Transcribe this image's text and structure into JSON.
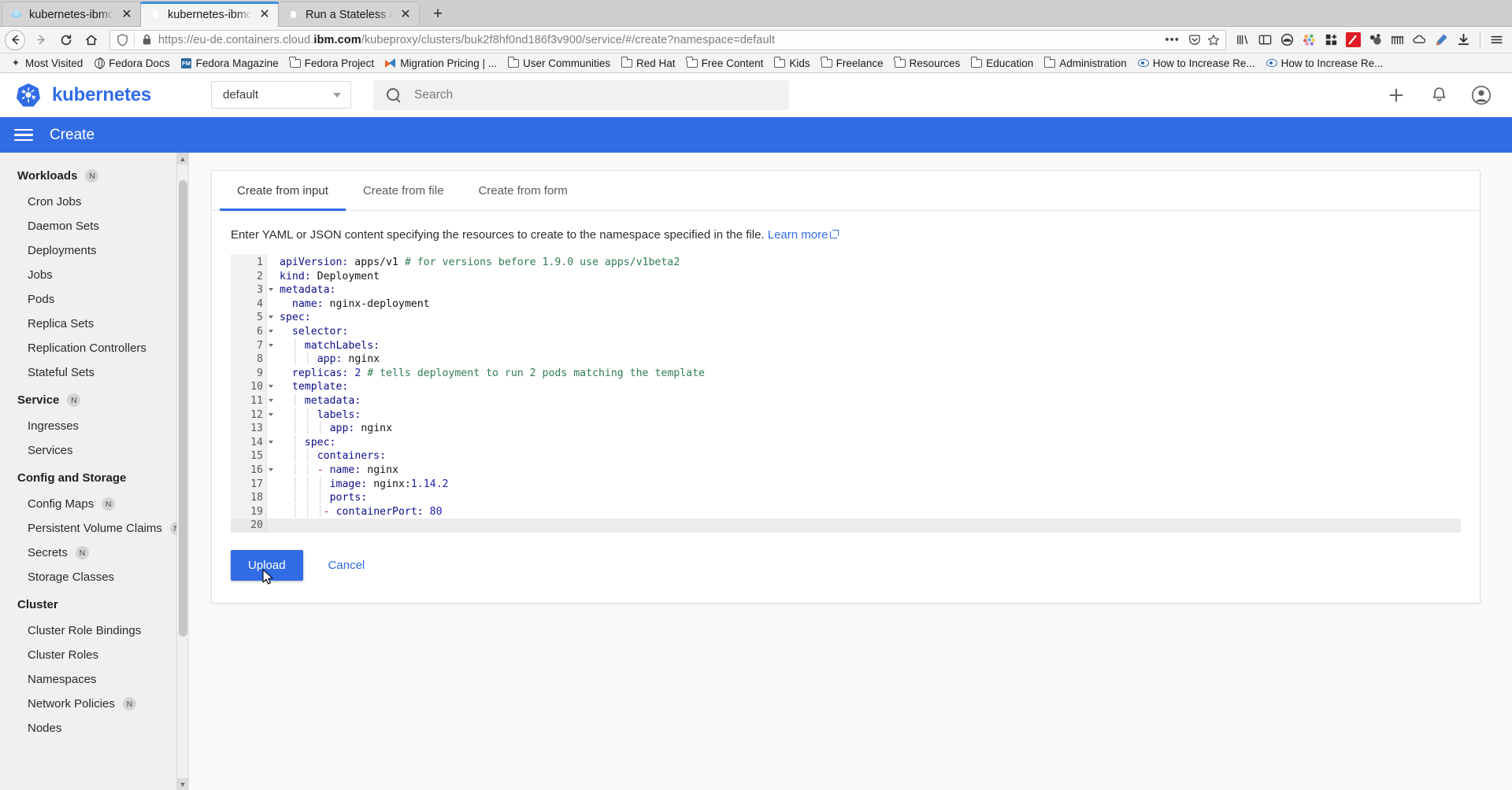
{
  "browser": {
    "tabs": [
      {
        "title": "kubernetes-ibmcloud - IB",
        "favicon": "cloud-icon",
        "active": false,
        "close_label": "✕"
      },
      {
        "title": "kubernetes-ibmcloud - K",
        "favicon": "kubernetes-icon",
        "active": true,
        "close_label": "✕"
      },
      {
        "title": "Run a Stateless Applicat",
        "favicon": "kubernetes-icon",
        "active": false,
        "close_label": "✕"
      }
    ],
    "new_tab_label": "+",
    "nav": {
      "back_label": "←",
      "forward_label": "→",
      "reload_label": "↻",
      "home_label": "⌂"
    },
    "url": {
      "scheme": "https://eu-de.containers.cloud.",
      "domain": "ibm.com",
      "path": "/kubeproxy/clusters/buk2f8hf0nd186f3v900/service/#/create?namespace=default",
      "shield_icon": "shield-icon",
      "lock_icon": "lock-icon",
      "overflow_label": "•••",
      "pocket_icon": "pocket-icon",
      "bookmark_star_icon": "star-icon"
    },
    "toolbar_icons": [
      "library-icon",
      "sidebar-icon",
      "containers-icon",
      "palette-icon",
      "grid-plus-icon",
      "wand-icon",
      "molecule-icon",
      "comb-icon",
      "cloud-icon",
      "highlighter-icon",
      "downloads-icon"
    ],
    "menu_icon": "hamburger-menu-icon",
    "bookmarks": [
      {
        "label": "Most Visited",
        "icon": "star-icon"
      },
      {
        "label": "Fedora Docs",
        "icon": "globe-icon"
      },
      {
        "label": "Fedora Magazine",
        "icon": "fm-icon"
      },
      {
        "label": "Fedora Project",
        "icon": "folder-icon"
      },
      {
        "label": "Migration Pricing | ...",
        "icon": "pin-icon"
      },
      {
        "label": "User Communities",
        "icon": "folder-icon"
      },
      {
        "label": "Red Hat",
        "icon": "folder-icon"
      },
      {
        "label": "Free Content",
        "icon": "folder-icon"
      },
      {
        "label": "Kids",
        "icon": "folder-icon"
      },
      {
        "label": "Freelance",
        "icon": "folder-icon"
      },
      {
        "label": "Resources",
        "icon": "folder-icon"
      },
      {
        "label": "Education",
        "icon": "folder-icon"
      },
      {
        "label": "Administration",
        "icon": "folder-icon"
      },
      {
        "label": "How to Increase Re...",
        "icon": "eye-icon"
      },
      {
        "label": "How to Increase Re...",
        "icon": "eye-icon"
      }
    ]
  },
  "app": {
    "brand_name": "kubernetes",
    "namespace_value": "default",
    "namespace_caret": "chevron-down-icon",
    "search_placeholder": "Search",
    "header_actions": [
      {
        "name": "add-button",
        "label": "+"
      },
      {
        "name": "notifications-button",
        "label": "🔔"
      },
      {
        "name": "account-button",
        "label": "👤"
      }
    ],
    "page_title": "Create",
    "accent_color": "#326ce5"
  },
  "sidebar": {
    "sections": [
      {
        "title": "Workloads",
        "badge": "N",
        "items": [
          {
            "label": "Cron Jobs",
            "badge": null
          },
          {
            "label": "Daemon Sets",
            "badge": null
          },
          {
            "label": "Deployments",
            "badge": null
          },
          {
            "label": "Jobs",
            "badge": null
          },
          {
            "label": "Pods",
            "badge": null
          },
          {
            "label": "Replica Sets",
            "badge": null
          },
          {
            "label": "Replication Controllers",
            "badge": null
          },
          {
            "label": "Stateful Sets",
            "badge": null
          }
        ]
      },
      {
        "title": "Service",
        "badge": "N",
        "items": [
          {
            "label": "Ingresses",
            "badge": null
          },
          {
            "label": "Services",
            "badge": null
          }
        ]
      },
      {
        "title": "Config and Storage",
        "badge": null,
        "items": [
          {
            "label": "Config Maps",
            "badge": "N"
          },
          {
            "label": "Persistent Volume Claims",
            "badge": "N"
          },
          {
            "label": "Secrets",
            "badge": "N"
          },
          {
            "label": "Storage Classes",
            "badge": null
          }
        ]
      },
      {
        "title": "Cluster",
        "badge": null,
        "items": [
          {
            "label": "Cluster Role Bindings",
            "badge": null
          },
          {
            "label": "Cluster Roles",
            "badge": null
          },
          {
            "label": "Namespaces",
            "badge": null
          },
          {
            "label": "Network Policies",
            "badge": "N"
          },
          {
            "label": "Nodes",
            "badge": null
          }
        ]
      }
    ],
    "scroll_up_icon": "chevron-up-icon",
    "scroll_down_icon": "chevron-down-icon"
  },
  "main": {
    "tabs": [
      {
        "label": "Create from input",
        "active": true
      },
      {
        "label": "Create from file",
        "active": false
      },
      {
        "label": "Create from form",
        "active": false
      }
    ],
    "description": "Enter YAML or JSON content specifying the resources to create to the namespace specified in the file.",
    "learn_more_label": "Learn more",
    "learn_more_icon": "external-link-icon",
    "editor": {
      "language": "yaml",
      "current_line": 20,
      "total_lines": 20,
      "lines": [
        {
          "n": 1,
          "fold": false,
          "text": "apiVersion: apps/v1 # for versions before 1.9.0 use apps/v1beta2"
        },
        {
          "n": 2,
          "fold": false,
          "text": "kind: Deployment"
        },
        {
          "n": 3,
          "fold": true,
          "text": "metadata:"
        },
        {
          "n": 4,
          "fold": false,
          "text": "  name: nginx-deployment"
        },
        {
          "n": 5,
          "fold": true,
          "text": "spec:"
        },
        {
          "n": 6,
          "fold": true,
          "text": "  selector:"
        },
        {
          "n": 7,
          "fold": true,
          "text": "    matchLabels:"
        },
        {
          "n": 8,
          "fold": false,
          "text": "      app: nginx"
        },
        {
          "n": 9,
          "fold": false,
          "text": "  replicas: 2 # tells deployment to run 2 pods matching the template"
        },
        {
          "n": 10,
          "fold": true,
          "text": "  template:"
        },
        {
          "n": 11,
          "fold": true,
          "text": "    metadata:"
        },
        {
          "n": 12,
          "fold": true,
          "text": "      labels:"
        },
        {
          "n": 13,
          "fold": false,
          "text": "        app: nginx"
        },
        {
          "n": 14,
          "fold": true,
          "text": "    spec:"
        },
        {
          "n": 15,
          "fold": false,
          "text": "      containers:"
        },
        {
          "n": 16,
          "fold": true,
          "text": "      - name: nginx"
        },
        {
          "n": 17,
          "fold": false,
          "text": "        image: nginx:1.14.2"
        },
        {
          "n": 18,
          "fold": false,
          "text": "        ports:"
        },
        {
          "n": 19,
          "fold": false,
          "text": "        - containerPort: 80"
        },
        {
          "n": 20,
          "fold": false,
          "text": ""
        }
      ]
    },
    "upload_label": "Upload",
    "cancel_label": "Cancel"
  }
}
